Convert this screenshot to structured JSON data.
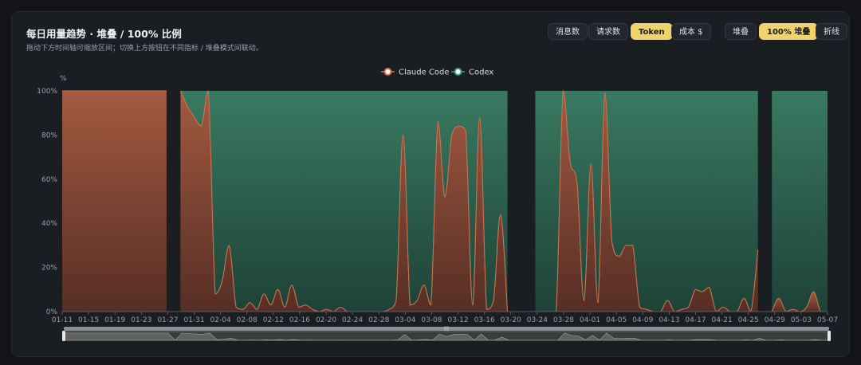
{
  "header": {
    "title": "每日用量趋势 · 堆叠 / 100% 比例",
    "subtitle": "拖动下方时间轴可缩放区间；切换上方按钮在不同指标 / 堆叠模式间联动。"
  },
  "metric_buttons": [
    {
      "label": "消息数",
      "active": false
    },
    {
      "label": "请求数",
      "active": false
    },
    {
      "label": "Token",
      "active": true
    },
    {
      "label": "成本 $",
      "active": false
    }
  ],
  "mode_buttons": [
    {
      "label": "堆叠",
      "active": false
    },
    {
      "label": "100% 堆叠",
      "active": true
    },
    {
      "label": "折线",
      "active": false
    }
  ],
  "colors": {
    "claude": "#d46e4e",
    "codex": "#3f9c7c",
    "accent": "#f2d26a"
  },
  "chart_data": {
    "type": "area",
    "stacked": "percent",
    "y_unit": "%",
    "ylim": [
      0,
      100
    ],
    "y_ticks": [
      "0%",
      "20%",
      "40%",
      "60%",
      "80%",
      "100%"
    ],
    "x_tick_labels": [
      "01-11",
      "01-15",
      "01-19",
      "01-23",
      "01-27",
      "01-31",
      "02-04",
      "02-08",
      "02-12",
      "02-16",
      "02-20",
      "02-24",
      "02-28",
      "03-04",
      "03-08",
      "03-12",
      "03-16",
      "03-20",
      "03-24",
      "03-28",
      "04-01",
      "04-05",
      "04-09",
      "04-13",
      "04-17",
      "04-21",
      "04-25",
      "04-29",
      "05-03",
      "05-07"
    ],
    "grid": false,
    "legend_position": "top-center",
    "series": [
      {
        "name": "Claude Code",
        "values": [
          100,
          100,
          100,
          100,
          100,
          100,
          100,
          100,
          100,
          100,
          100,
          100,
          100,
          100,
          100,
          100,
          null,
          100,
          93,
          88,
          84,
          100,
          8,
          14,
          30,
          2,
          1,
          4,
          1,
          8,
          3,
          10,
          2,
          12,
          2,
          3,
          1,
          0,
          1,
          0,
          2,
          0,
          0,
          0,
          0,
          0,
          0,
          1,
          5,
          80,
          3,
          5,
          12,
          3,
          86,
          52,
          80,
          84,
          82,
          3,
          88,
          1,
          5,
          44,
          0,
          null,
          null,
          null,
          0,
          0,
          0,
          0,
          100,
          68,
          58,
          5,
          67,
          4,
          99,
          32,
          25,
          30,
          30,
          2,
          1,
          0,
          0,
          5,
          0,
          1,
          2,
          10,
          9,
          11,
          0,
          2,
          0,
          0,
          6,
          0,
          28,
          null,
          0,
          6,
          0,
          1,
          0,
          2,
          9,
          0,
          0
        ]
      },
      {
        "name": "Codex",
        "values": [
          0,
          0,
          0,
          0,
          0,
          0,
          0,
          0,
          0,
          0,
          0,
          0,
          0,
          0,
          0,
          0,
          null,
          0,
          7,
          12,
          16,
          0,
          92,
          86,
          70,
          98,
          99,
          96,
          99,
          92,
          97,
          90,
          98,
          88,
          98,
          97,
          99,
          100,
          99,
          100,
          98,
          100,
          100,
          100,
          100,
          100,
          100,
          99,
          95,
          20,
          97,
          95,
          88,
          97,
          14,
          48,
          20,
          16,
          18,
          97,
          12,
          99,
          95,
          56,
          100,
          null,
          null,
          null,
          100,
          100,
          100,
          100,
          0,
          32,
          42,
          95,
          33,
          96,
          1,
          68,
          75,
          70,
          70,
          98,
          99,
          100,
          100,
          95,
          100,
          99,
          98,
          90,
          91,
          89,
          100,
          98,
          100,
          100,
          94,
          100,
          72,
          null,
          100,
          94,
          100,
          99,
          100,
          98,
          91,
          100,
          100
        ]
      }
    ]
  }
}
